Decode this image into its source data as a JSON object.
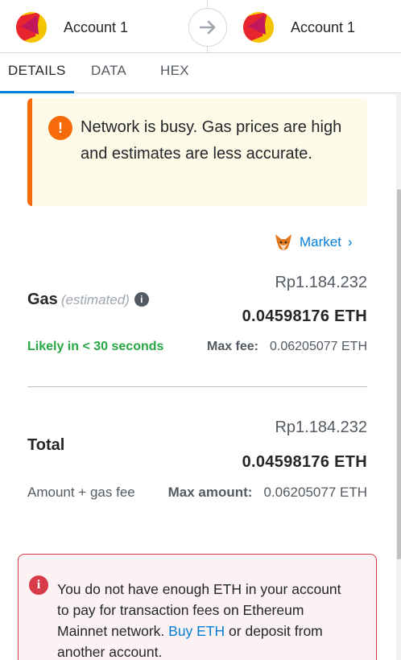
{
  "header": {
    "from_account": "Account 1",
    "to_account": "Account 1",
    "arrow_icon": "arrow-right-icon"
  },
  "tabs": [
    {
      "label": "DETAILS",
      "active": true
    },
    {
      "label": "DATA",
      "active": false
    },
    {
      "label": "HEX",
      "active": false
    }
  ],
  "warning": {
    "text": "Network is busy. Gas prices are high and estimates are less accurate.",
    "icon": "exclamation-icon",
    "color": "#f66a0a"
  },
  "market": {
    "label": "Market",
    "icon": "fox-icon",
    "chevron": "›"
  },
  "gas": {
    "label": "Gas",
    "estimated": "(estimated)",
    "fiat": "Rp1.184.232",
    "eth": "0.04598176 ETH",
    "likely": "Likely in < 30 seconds",
    "max_fee_label": "Max fee:",
    "max_fee_value": "0.06205077 ETH"
  },
  "total": {
    "label": "Total",
    "fiat": "Rp1.184.232",
    "eth": "0.04598176 ETH",
    "subtitle": "Amount + gas fee",
    "max_amount_label": "Max amount:",
    "max_amount_value": "0.06205077 ETH"
  },
  "error": {
    "text_before": "You do not have enough ETH in your account to pay for transaction fees on Ethereum Mainnet network.",
    "link": "Buy ETH",
    "text_after": "or deposit from another account.",
    "icon": "info-icon",
    "color": "#d73a49"
  },
  "colors": {
    "link_blue": "#037dd6",
    "success_green": "#28a745"
  }
}
